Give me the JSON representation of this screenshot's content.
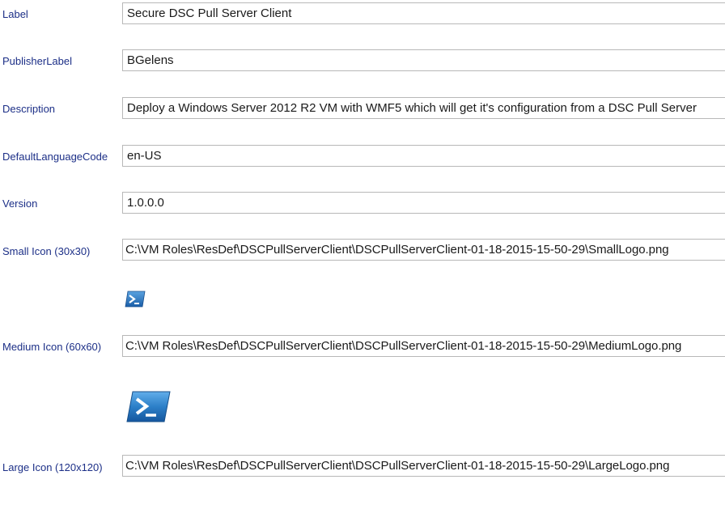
{
  "form": {
    "label": {
      "caption": "Label",
      "value": "Secure DSC Pull Server Client"
    },
    "publisher": {
      "caption": "PublisherLabel",
      "value": "BGelens"
    },
    "description": {
      "caption": "Description",
      "value": "Deploy a Windows Server 2012 R2 VM with WMF5 which will get it's configuration from a DSC Pull Server"
    },
    "language": {
      "caption": "DefaultLanguageCode",
      "value": "en-US"
    },
    "version": {
      "caption": "Version",
      "value": "1.0.0.0"
    },
    "small_icon": {
      "caption": "Small Icon (30x30)",
      "value": "C:\\VM Roles\\ResDef\\DSCPullServerClient\\DSCPullServerClient-01-18-2015-15-50-29\\SmallLogo.png",
      "preview": "powershell-icon"
    },
    "medium_icon": {
      "caption": "Medium Icon (60x60)",
      "value": "C:\\VM Roles\\ResDef\\DSCPullServerClient\\DSCPullServerClient-01-18-2015-15-50-29\\MediumLogo.png",
      "preview": "powershell-icon"
    },
    "large_icon": {
      "caption": "Large Icon (120x120)",
      "value": "C:\\VM Roles\\ResDef\\DSCPullServerClient\\DSCPullServerClient-01-18-2015-15-50-29\\LargeLogo.png"
    }
  },
  "colors": {
    "label_text": "#1c2f87",
    "field_border": "#b8b8b8",
    "icon_blue": "#1f6fb4"
  }
}
